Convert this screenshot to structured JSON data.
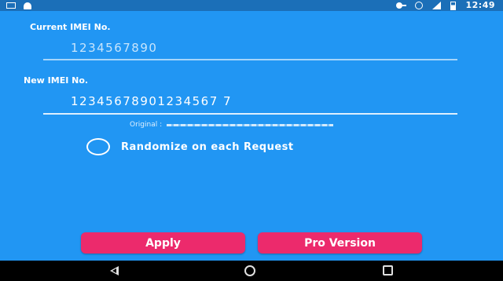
{
  "status_bar": {
    "time": "12:49",
    "left_icons": [
      "mail-icon",
      "android-icon"
    ],
    "right_icons": [
      "vpn-key-icon",
      "alarm-icon",
      "signal-icon",
      "battery-icon"
    ]
  },
  "current_imei": {
    "label": "Current IMEI No.",
    "value": "1234567890"
  },
  "new_imei": {
    "label": "New IMEI No.",
    "value": "12345678901234567 7"
  },
  "original": {
    "label": "Original :"
  },
  "randomize": {
    "label": "Randomize on each Request",
    "checked": false
  },
  "buttons": {
    "apply": "Apply",
    "pro": "Pro Version"
  },
  "nav_bar": {
    "icons": [
      "back-icon",
      "home-icon",
      "recents-icon"
    ]
  },
  "colors": {
    "background": "#2196f3",
    "status_bar": "#1b6fb8",
    "button": "#ec2a6c",
    "nav_bar": "#000000"
  }
}
